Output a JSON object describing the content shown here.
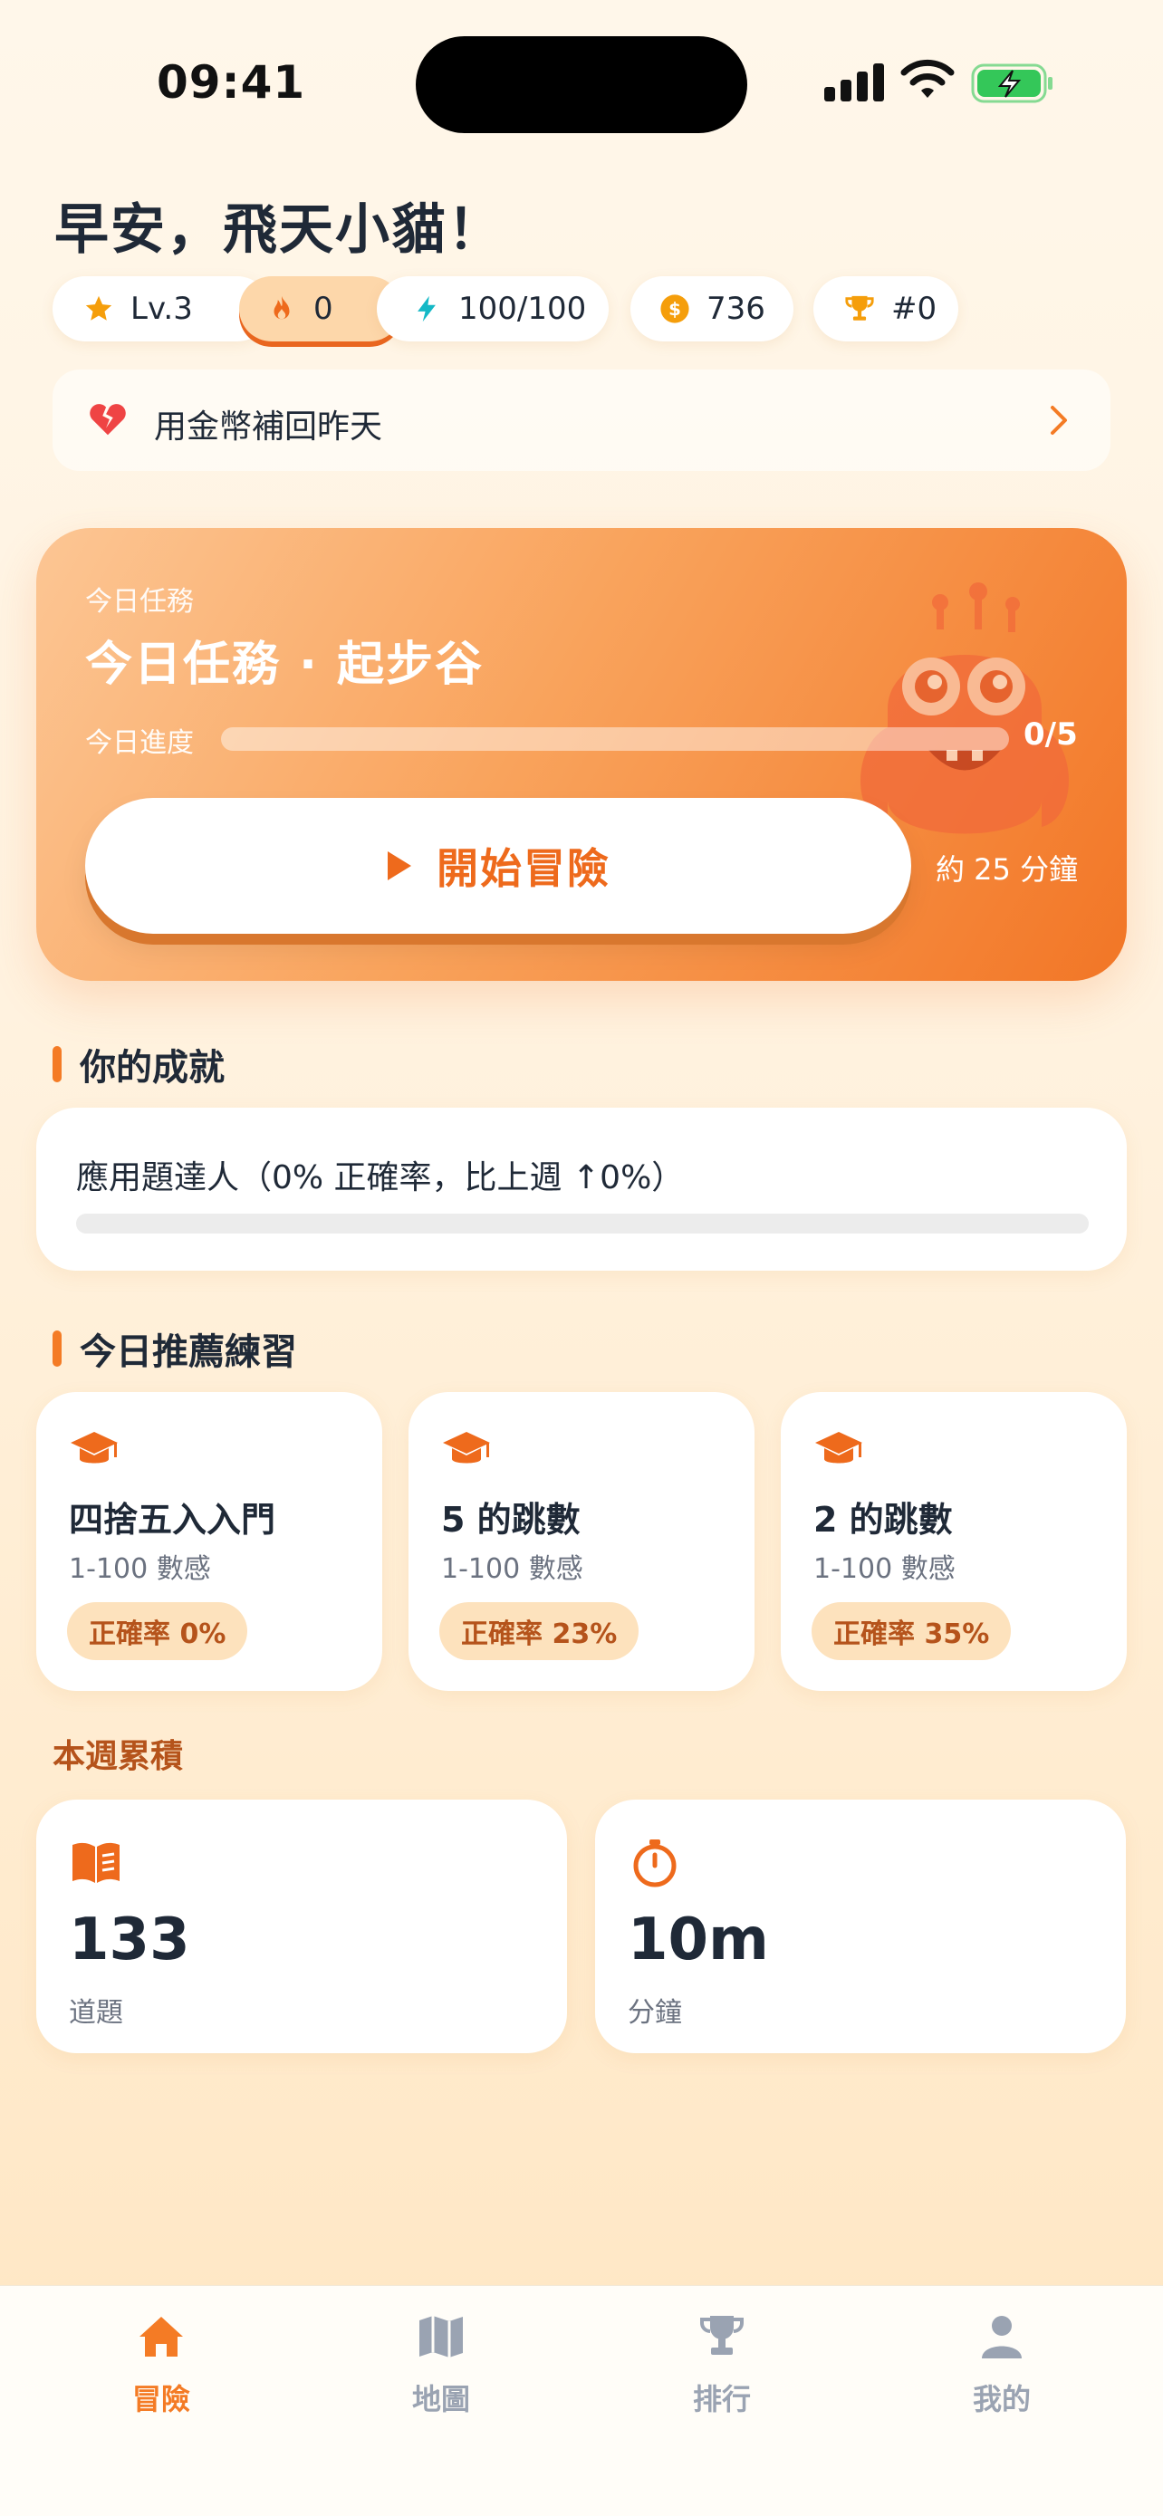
{
  "status": {
    "time": "09:41"
  },
  "header": {
    "greeting": "早安，飛天小貓！",
    "chips": {
      "level": "Lv.3",
      "streak": "0",
      "energy": "100/100",
      "coins": "736",
      "rank": "#0"
    }
  },
  "makeup": {
    "label": "用金幣補回昨天"
  },
  "quest": {
    "small_label": "今日任務",
    "title": "今日任務 · 起步谷",
    "progress_label": "今日進度",
    "progress_done": 0,
    "progress_total": 5,
    "progress_text": "0/5",
    "start_label": "開始冒險",
    "estimate": "約 25 分鐘"
  },
  "achievements": {
    "title": "你的成就",
    "item_text": "應用題達人（0% 正確率，比上週 ↑0%）",
    "progress": 0
  },
  "recommended": {
    "title": "今日推薦練習",
    "items": [
      {
        "name": "四捨五入入門",
        "sub": "1-100 數感",
        "accuracy": "正確率 0%"
      },
      {
        "name": "5 的跳數",
        "sub": "1-100 數感",
        "accuracy": "正確率 23%"
      },
      {
        "name": "2 的跳數",
        "sub": "1-100 數感",
        "accuracy": "正確率 35%"
      }
    ]
  },
  "weekly": {
    "title": "本週累積",
    "stats": [
      {
        "value": "133",
        "label": "道題",
        "icon": "book-icon"
      },
      {
        "value": "10m",
        "label": "分鐘",
        "icon": "stopwatch-icon"
      }
    ]
  },
  "tabs": [
    {
      "label": "冒險",
      "icon": "home-icon",
      "active": true
    },
    {
      "label": "地圖",
      "icon": "map-icon",
      "active": false
    },
    {
      "label": "排行",
      "icon": "trophy-icon",
      "active": false
    },
    {
      "label": "我的",
      "icon": "user-icon",
      "active": false
    }
  ],
  "colors": {
    "accent": "#f47b25",
    "accent_dark": "#b5531b",
    "badge_bg": "#fde2bd",
    "tab_inactive": "#9aa3b2"
  }
}
